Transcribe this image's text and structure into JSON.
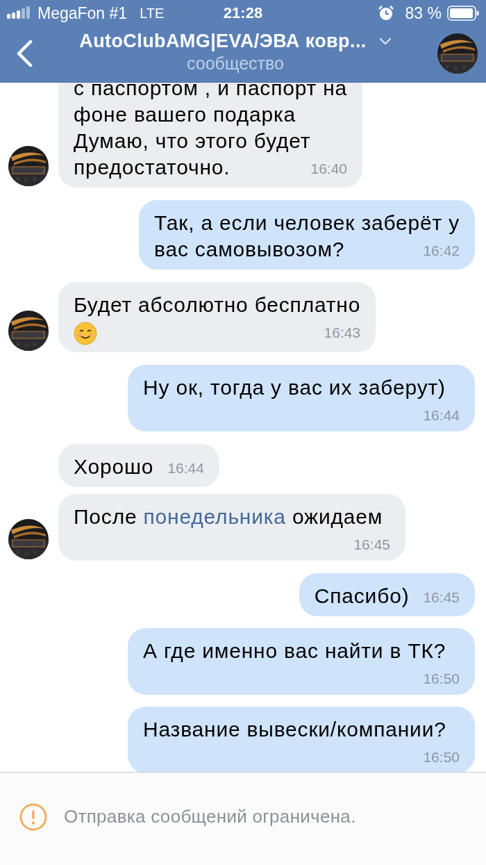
{
  "status_bar": {
    "carrier": "MegaFon #1",
    "network": "LTE",
    "time": "21:28",
    "battery": "83 %"
  },
  "header": {
    "title": "AutoClubAMG|EVA/ЭВА ковр...",
    "subtitle": "сообщество"
  },
  "messages": [
    {
      "kind": "in",
      "avatar": true,
      "lines": [
        "с паспортом , и паспорт на",
        "фоне вашего подарка",
        "Думаю, что этого будет",
        "предостаточно."
      ],
      "time": "16:40"
    },
    {
      "kind": "out",
      "lines": [
        "Так, а если человек заберёт у",
        "вас самовывозом?"
      ],
      "time": "16:42"
    },
    {
      "kind": "in",
      "avatar": true,
      "parts": [
        {
          "kind": "text",
          "text": "Будет абсолютно бесплатно"
        },
        {
          "kind": "emoji"
        }
      ],
      "time": "16:43"
    },
    {
      "kind": "out",
      "parts": [
        {
          "kind": "text",
          "text": "Ну ок, тогда у вас их заберут)"
        }
      ],
      "time": "16:44"
    },
    {
      "kind": "in",
      "avatar": false,
      "parts": [
        {
          "kind": "text",
          "text": "Хорошо"
        }
      ],
      "time": "16:44"
    },
    {
      "kind": "in",
      "avatar": true,
      "parts": [
        {
          "kind": "text",
          "text": "После "
        },
        {
          "kind": "link",
          "text": "понедельника"
        },
        {
          "kind": "text",
          "text": " ожидаем"
        }
      ],
      "time": "16:45"
    },
    {
      "kind": "out",
      "parts": [
        {
          "kind": "text",
          "text": "Спасибо)"
        }
      ],
      "time": "16:45"
    },
    {
      "kind": "out",
      "parts": [
        {
          "kind": "text",
          "text": "А где именно вас найти в ТК?"
        }
      ],
      "time": "16:50"
    },
    {
      "kind": "out",
      "parts": [
        {
          "kind": "text",
          "text": "Название вывески/компании?"
        }
      ],
      "time": "16:50"
    }
  ],
  "footer": {
    "notice": "Отправка сообщений ограничена."
  }
}
